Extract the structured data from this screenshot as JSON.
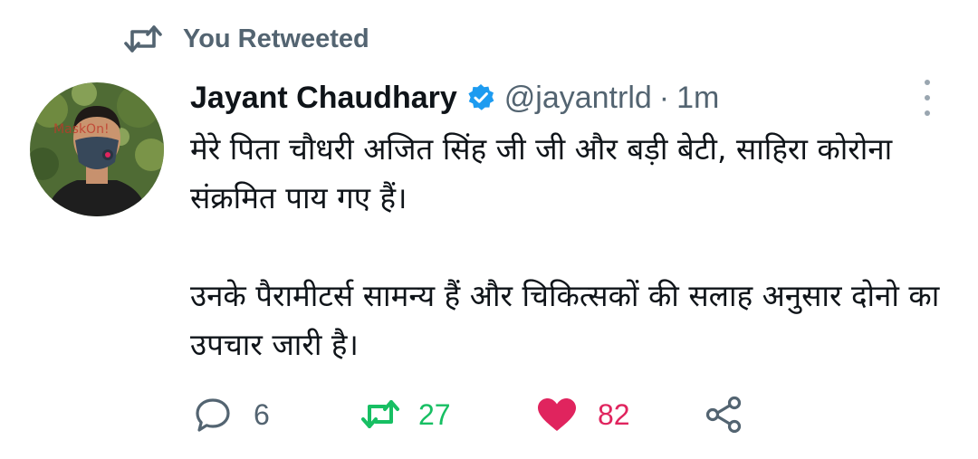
{
  "retweet_header": {
    "label": "You Retweeted",
    "icon": "retweet-icon"
  },
  "tweet": {
    "author": {
      "name": "Jayant Chaudhary",
      "handle": "@jayantrld",
      "verified": true,
      "avatar_watermark": "MaskOn!"
    },
    "time": "1m",
    "separator": "·",
    "paragraphs": [
      "मेरे पिता चौधरी अजित सिंह जी जी और बड़ी बेटी, साहिरा कोरोना संक्रमित पाय गए हैं।",
      "उनके पैरामीटर्स सामन्य हैं और चिकित्सकों की सलाह अनुसार दोनो का उपचार जारी है।"
    ],
    "actions": {
      "reply": {
        "count": "6",
        "icon": "reply-icon"
      },
      "retweet": {
        "count": "27",
        "icon": "retweet-icon"
      },
      "like": {
        "count": "82",
        "icon": "heart-icon"
      },
      "share": {
        "icon": "share-icon"
      }
    }
  },
  "colors": {
    "muted": "#536471",
    "retweet_active": "#17bf63",
    "like_active": "#e0245e",
    "verified": "#1d9bf0"
  }
}
